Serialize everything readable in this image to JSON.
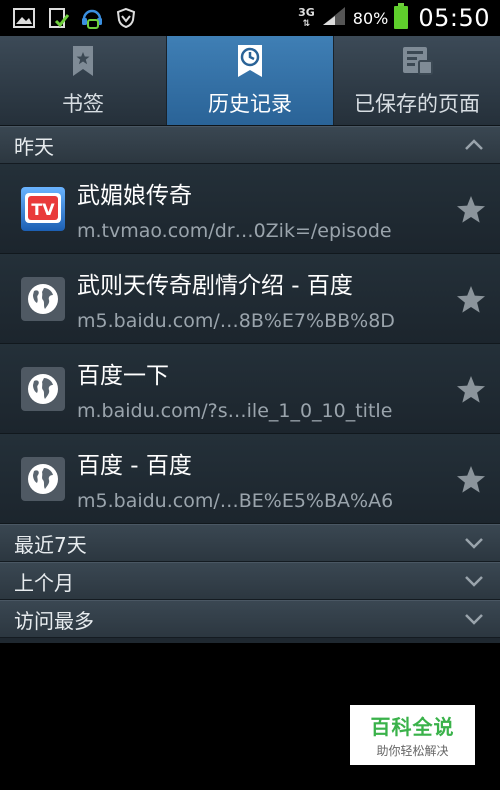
{
  "status": {
    "network": "3G",
    "battery": "80%",
    "time": "05:50"
  },
  "tabs": [
    {
      "label": "书签",
      "icon": "bookmark-icon",
      "active": false
    },
    {
      "label": "历史记录",
      "icon": "history-clock-icon",
      "active": true
    },
    {
      "label": "已保存的页面",
      "icon": "saved-pages-icon",
      "active": false
    }
  ],
  "history": {
    "groups": [
      {
        "label": "昨天",
        "expanded": true
      },
      {
        "label": "最近7天",
        "expanded": false
      },
      {
        "label": "上个月",
        "expanded": false
      },
      {
        "label": "访问最多",
        "expanded": false
      }
    ],
    "items": [
      {
        "title": "武媚娘传奇",
        "url": "m.tvmao.com/dr…0Zik=/episode",
        "favicon": "tvmao-logo-icon",
        "favicon_text": "TV"
      },
      {
        "title": "武则天传奇剧情介绍 - 百度",
        "url": "m5.baidu.com/…8B%E7%BB%8D",
        "favicon": "globe-icon"
      },
      {
        "title": "百度一下",
        "url": "m.baidu.com/?s…ile_1_0_10_title",
        "favicon": "globe-icon"
      },
      {
        "title": "百度 - 百度",
        "url": "m5.baidu.com/…BE%E5%BA%A6",
        "favicon": "globe-icon"
      }
    ]
  },
  "watermark": {
    "title": "百科全说",
    "subtitle": "助你轻松解决"
  },
  "colors": {
    "active_tab": "#2f6fa6",
    "battery": "#5fcf2c",
    "watermark_green": "#3ab24a"
  }
}
